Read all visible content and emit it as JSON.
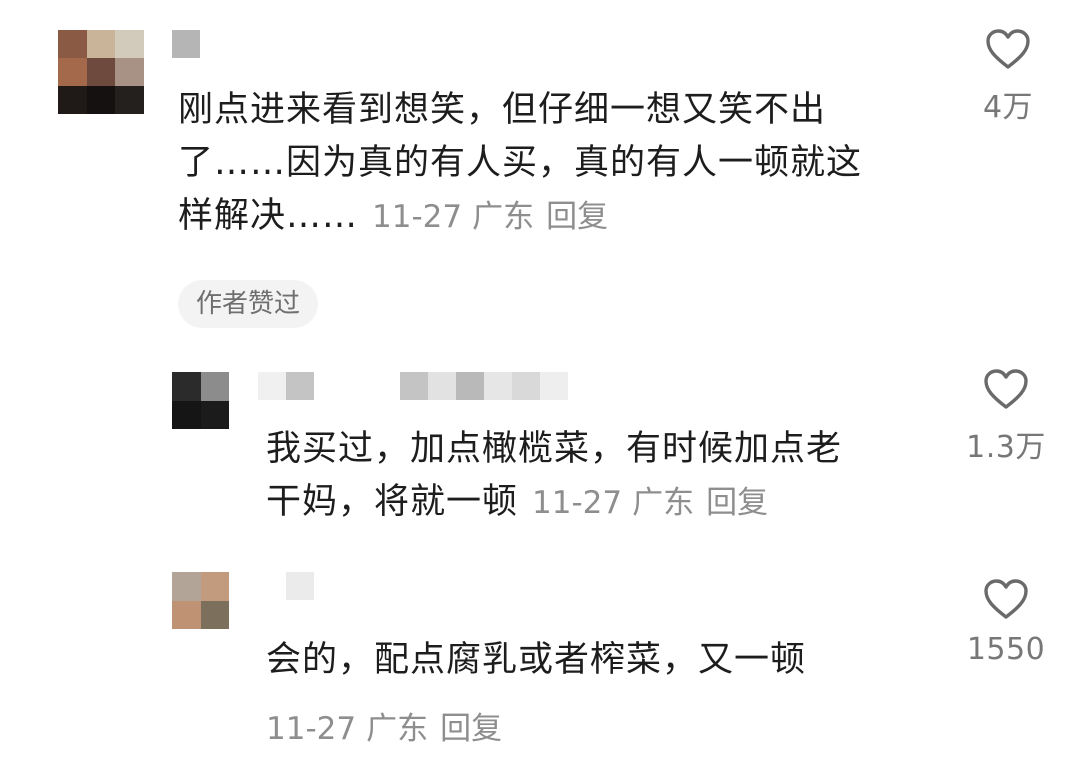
{
  "comments": [
    {
      "lines": [
        "刚点进来看到想笑，但仔细一想又笑不出",
        "了……因为真的有人买，真的有人一顿就这",
        "样解决……"
      ],
      "date": "11-27",
      "location": "广东",
      "reply_label": "回复",
      "badge": "作者赞过",
      "likes": "4万"
    },
    {
      "lines": [
        "我买过，加点橄榄菜，有时候加点老",
        "干妈，将就一顿"
      ],
      "date": "11-27",
      "location": "广东",
      "reply_label": "回复",
      "likes": "1.3万"
    },
    {
      "lines": [
        "会的，配点腐乳或者榨菜，又一顿"
      ],
      "date": "11-27",
      "location": "广东",
      "reply_label": "回复",
      "likes": "1550"
    }
  ],
  "icons": {
    "like": "heart-outline-icon"
  },
  "colors": {
    "text": "#1d1d1d",
    "meta": "#8e8e8e",
    "badge_bg": "#f3f3f3"
  }
}
